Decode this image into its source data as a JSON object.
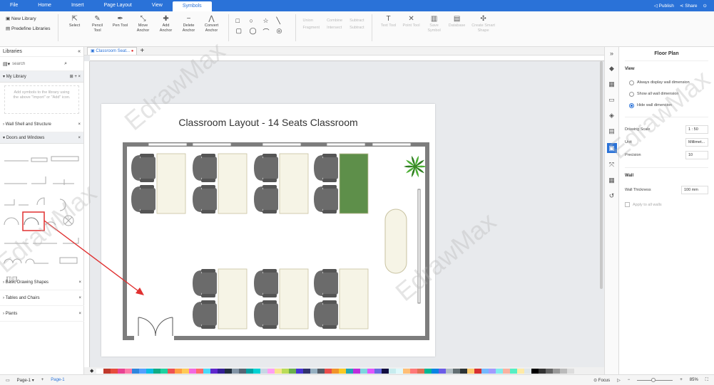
{
  "menubar": {
    "items": [
      "File",
      "Home",
      "Insert",
      "Page Layout",
      "View",
      "Symbols"
    ],
    "active_index": 5,
    "publish": "Publish",
    "share": "Share"
  },
  "ribbon": {
    "new_library": "New Library",
    "predefine_libraries": "Predefine Libraries",
    "select": "Select",
    "pencil_tool": "Pencil Tool",
    "pen_tool": "Pen Tool",
    "move_anchor": "Move Anchor",
    "add_anchor": "Add Anchor",
    "delete_anchor": "Delete Anchor",
    "convert_anchor": "Convert Anchor",
    "union": "Union",
    "combine": "Combine",
    "subtract": "Subtract",
    "fragment": "Fragment",
    "intersect": "Intersect",
    "subtract2": "Subtract",
    "text_tool": "Text Tool",
    "point_tool": "Point Tool",
    "save_symbol": "Save Symbol",
    "database": "Database",
    "create_smart_shape": "Create Smart Shape"
  },
  "left_panel": {
    "title": "Libraries",
    "search_placeholder": "search",
    "my_library": "My Library",
    "hint": "Add symbols to the library using the above \"Import\" or \"Add\" icon.",
    "sections": [
      "Wall Shell and Structure",
      "Doors and Windows"
    ],
    "collapsed": [
      "Basic Drawing Shapes",
      "Tables and Chairs",
      "Plants"
    ]
  },
  "canvas": {
    "tab_label": "Classroom Seat...",
    "page_title": "Classroom Layout - 14 Seats Classroom",
    "colors": {
      "chair": "#6b6b6b",
      "desk": "#f6f4e6",
      "wall": "#7d7d7d",
      "accent": "#2a72d8",
      "highlight": "#e03030",
      "green_desk": "#5e8f4a"
    }
  },
  "right_panel": {
    "title": "Floor Plan",
    "view_label": "View",
    "options": [
      "Always display wall dimension",
      "Show all wall dimension",
      "Hide wall dimension"
    ],
    "selected_option": 2,
    "drawing_scale_label": "Drawing Scale",
    "drawing_scale_value": "1 : 50",
    "unit_label": "Unit",
    "unit_value": "Millimet...",
    "precision_label": "Precision",
    "precision_value": "10",
    "wall_label": "Wall",
    "wall_thickness_label": "Wall Thickness",
    "wall_thickness_value": "100 mm",
    "apply_all": "Apply to all walls"
  },
  "status": {
    "page_selector": "Page-1",
    "page_tab": "Page-1",
    "focus": "Focus",
    "zoom": "85%"
  },
  "watermark": "EdrawMax"
}
